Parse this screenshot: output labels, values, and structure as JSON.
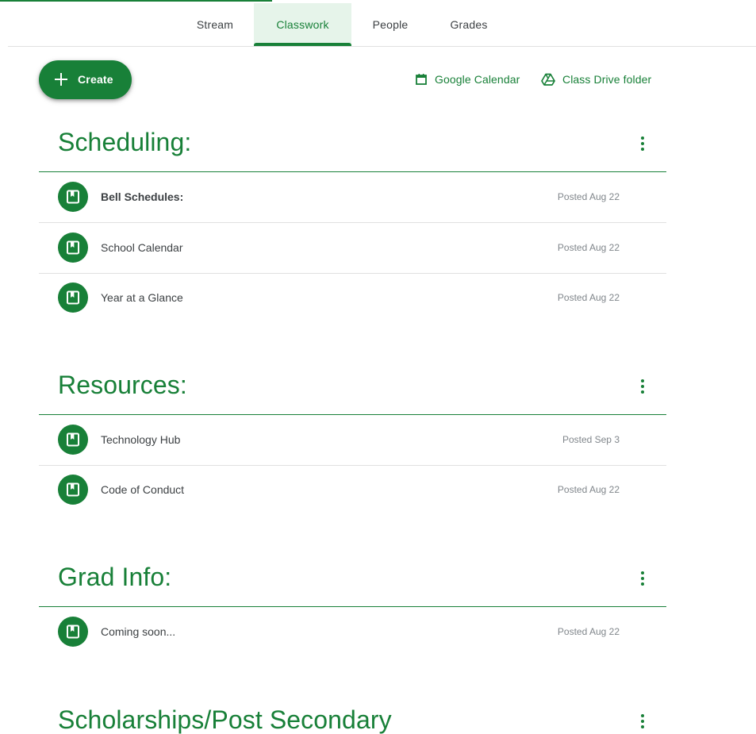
{
  "tabs": [
    {
      "label": "Stream"
    },
    {
      "label": "Classwork"
    },
    {
      "label": "People"
    },
    {
      "label": "Grades"
    }
  ],
  "create_button": {
    "label": "Create",
    "icon": "plus-icon"
  },
  "links": {
    "calendar": {
      "label": "Google Calendar",
      "icon": "calendar-icon"
    },
    "drive": {
      "label": "Class Drive folder",
      "icon": "drive-icon"
    }
  },
  "colors": {
    "accent": "#188038",
    "active_tab_bg": "#e6f4ea",
    "muted_text": "#80868b"
  },
  "sections": [
    {
      "title": "Scheduling:",
      "items": [
        {
          "title": "Bell Schedules:",
          "date": "Posted Aug 22",
          "icon": "material-icon"
        },
        {
          "title": "School Calendar",
          "date": "Posted Aug 22",
          "icon": "material-icon"
        },
        {
          "title": "Year at a Glance",
          "date": "Posted Aug 22",
          "icon": "material-icon"
        }
      ]
    },
    {
      "title": "Resources:",
      "items": [
        {
          "title": "Technology Hub",
          "date": "Posted Sep 3",
          "icon": "material-icon"
        },
        {
          "title": "Code of Conduct",
          "date": "Posted Aug 22",
          "icon": "material-icon"
        }
      ]
    },
    {
      "title": "Grad Info:",
      "items": [
        {
          "title": "Coming soon...",
          "date": "Posted Aug 22",
          "icon": "material-icon"
        }
      ]
    },
    {
      "title": "Scholarships/Post Secondary",
      "items": []
    }
  ]
}
